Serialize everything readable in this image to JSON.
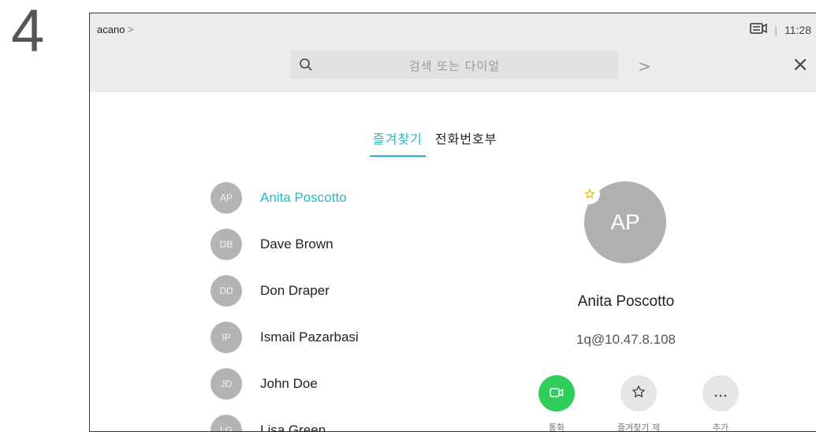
{
  "step_number": "4",
  "topbar": {
    "brand": "acano",
    "brand_chevron": ">",
    "time": "11:28",
    "separator": "|",
    "search_placeholder": "검색 또는 다이얼",
    "search_go": ">",
    "close": "×"
  },
  "tabs": [
    {
      "label": "즐겨찾기",
      "active": true
    },
    {
      "label": "전화번호부",
      "active": false
    }
  ],
  "contacts": [
    {
      "initials": "AP",
      "name": "Anita Poscotto",
      "selected": true
    },
    {
      "initials": "DB",
      "name": "Dave Brown"
    },
    {
      "initials": "DD",
      "name": "Don Draper"
    },
    {
      "initials": "IP",
      "name": "Ismail Pazarbasi"
    },
    {
      "initials": "JD",
      "name": "John Doe"
    },
    {
      "initials": "LG",
      "name": "Lisa Green"
    }
  ],
  "detail": {
    "initials": "AP",
    "name": "Anita Poscotto",
    "address": "1q@10.47.8.108"
  },
  "actions": [
    {
      "label": "통화",
      "icon": "video-camera-icon"
    },
    {
      "label": "즐겨찾기 제",
      "icon": "star-icon"
    },
    {
      "label": "추가",
      "icon": "more-icon"
    }
  ],
  "colors": {
    "accent": "#24b8c8",
    "call_green": "#2fcd5a",
    "avatar_gray": "#b4b4b4",
    "topbar_bg": "#ededed"
  }
}
